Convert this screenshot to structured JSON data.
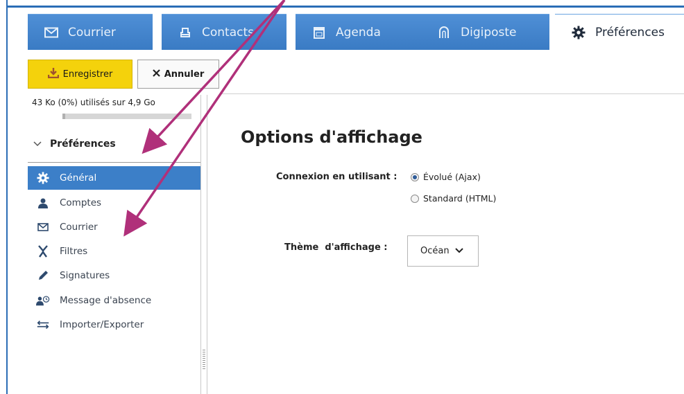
{
  "tabs": [
    {
      "label": "Courrier",
      "icon": "envelope-icon"
    },
    {
      "label": "Contacts",
      "icon": "contacts-icon"
    },
    {
      "label": "Agenda",
      "icon": "calendar-icon"
    },
    {
      "label": "Digiposte",
      "icon": "digiposte-icon"
    },
    {
      "label": "Préférences",
      "icon": "gear-icon",
      "active": true
    }
  ],
  "toolbar": {
    "save_label": "Enregistrer",
    "cancel_label": "Annuler"
  },
  "quota": {
    "text": "43 Ko (0%) utilisés sur 4,9 Go",
    "percent": 0
  },
  "sidebar": {
    "section_title": "Préférences",
    "items": [
      {
        "label": "Général",
        "icon": "gear-icon",
        "active": true
      },
      {
        "label": "Comptes",
        "icon": "user-icon"
      },
      {
        "label": "Courrier",
        "icon": "envelope-icon"
      },
      {
        "label": "Filtres",
        "icon": "filter-icon"
      },
      {
        "label": "Signatures",
        "icon": "pen-icon"
      },
      {
        "label": "Message d'absence",
        "icon": "user-clock-icon"
      },
      {
        "label": "Importer/Exporter",
        "icon": "import-export-icon"
      }
    ]
  },
  "content": {
    "title": "Options d'affichage",
    "login_label": "Connexion en utilisant :",
    "login_options": [
      {
        "label": "Évolué (Ajax)",
        "checked": true
      },
      {
        "label": "Standard (HTML)",
        "checked": false
      }
    ],
    "theme_label": "Thème  d'affichage :",
    "theme_value": "Océan"
  },
  "colors": {
    "accent": "#3c7fc8",
    "save_button": "#f4d20c",
    "annotation_arrow": "#b0307a"
  }
}
